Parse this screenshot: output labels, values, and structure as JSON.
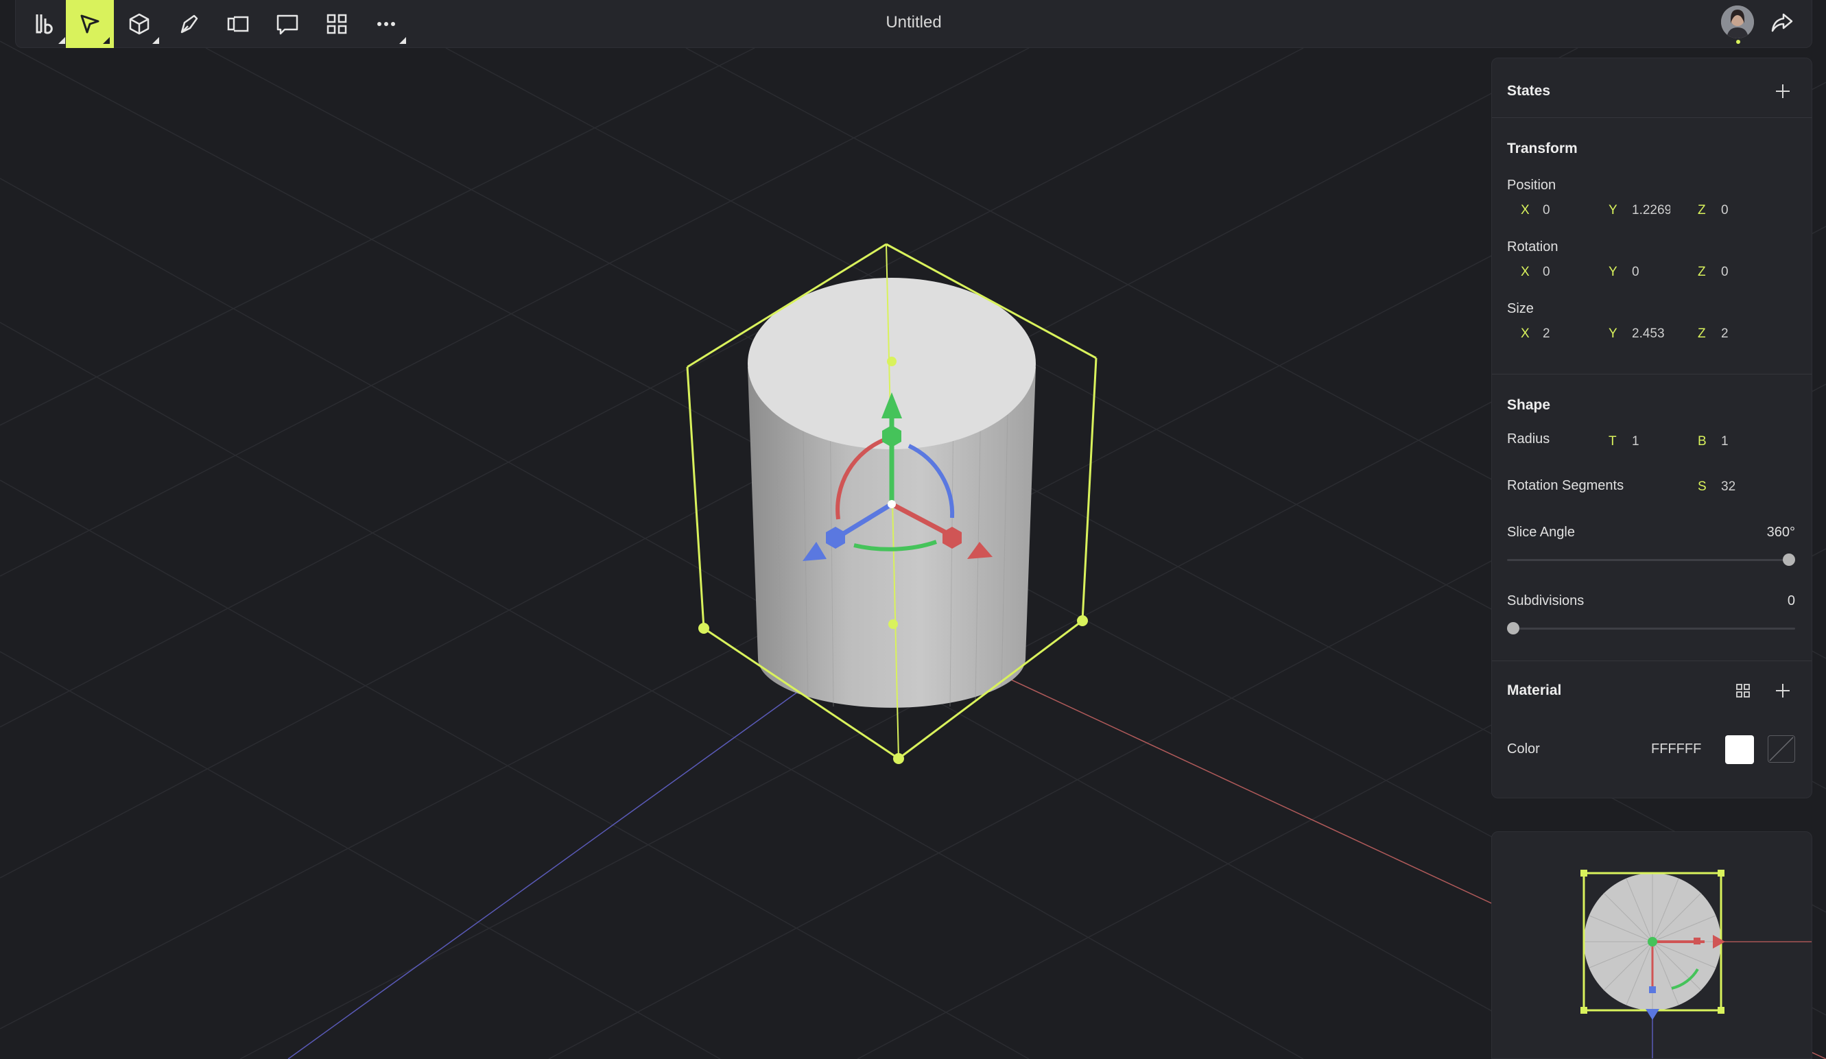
{
  "app": {
    "title": "Untitled"
  },
  "toolbar": {
    "tools": [
      {
        "name": "logo-menu",
        "icon": "logo-icon"
      },
      {
        "name": "select-tool",
        "icon": "cursor-icon",
        "active": true
      },
      {
        "name": "object-tool",
        "icon": "cube-icon"
      },
      {
        "name": "pen-tool",
        "icon": "pen-icon"
      },
      {
        "name": "artboard-tool",
        "icon": "frame-icon"
      },
      {
        "name": "comment-tool",
        "icon": "comment-icon"
      },
      {
        "name": "components-tool",
        "icon": "grid-icon"
      },
      {
        "name": "more-tools",
        "icon": "ellipsis-icon"
      }
    ],
    "accent_color": "#d9f25c"
  },
  "panel": {
    "states": {
      "title": "States"
    },
    "transform": {
      "title": "Transform",
      "position": {
        "label": "Position",
        "x_label": "X",
        "x": "0",
        "y_label": "Y",
        "y": "1.2269",
        "z_label": "Z",
        "z": "0"
      },
      "rotation": {
        "label": "Rotation",
        "x_label": "X",
        "x": "0",
        "y_label": "Y",
        "y": "0",
        "z_label": "Z",
        "z": "0"
      },
      "size": {
        "label": "Size",
        "x_label": "X",
        "x": "2",
        "y_label": "Y",
        "y": "2.453",
        "z_label": "Z",
        "z": "2"
      }
    },
    "shape": {
      "title": "Shape",
      "radius": {
        "label": "Radius",
        "t_label": "T",
        "t": "1",
        "b_label": "B",
        "b": "1"
      },
      "segments": {
        "label": "Rotation Segments",
        "s_label": "S",
        "s": "32"
      },
      "slice_angle": {
        "label": "Slice Angle",
        "value": "360°",
        "fraction": 1.0
      },
      "subdivisions": {
        "label": "Subdivisions",
        "value": "0",
        "fraction": 0.0
      }
    },
    "material": {
      "title": "Material",
      "color_label": "Color",
      "color_value": "FFFFFF",
      "swatch_color": "#ffffff"
    }
  }
}
